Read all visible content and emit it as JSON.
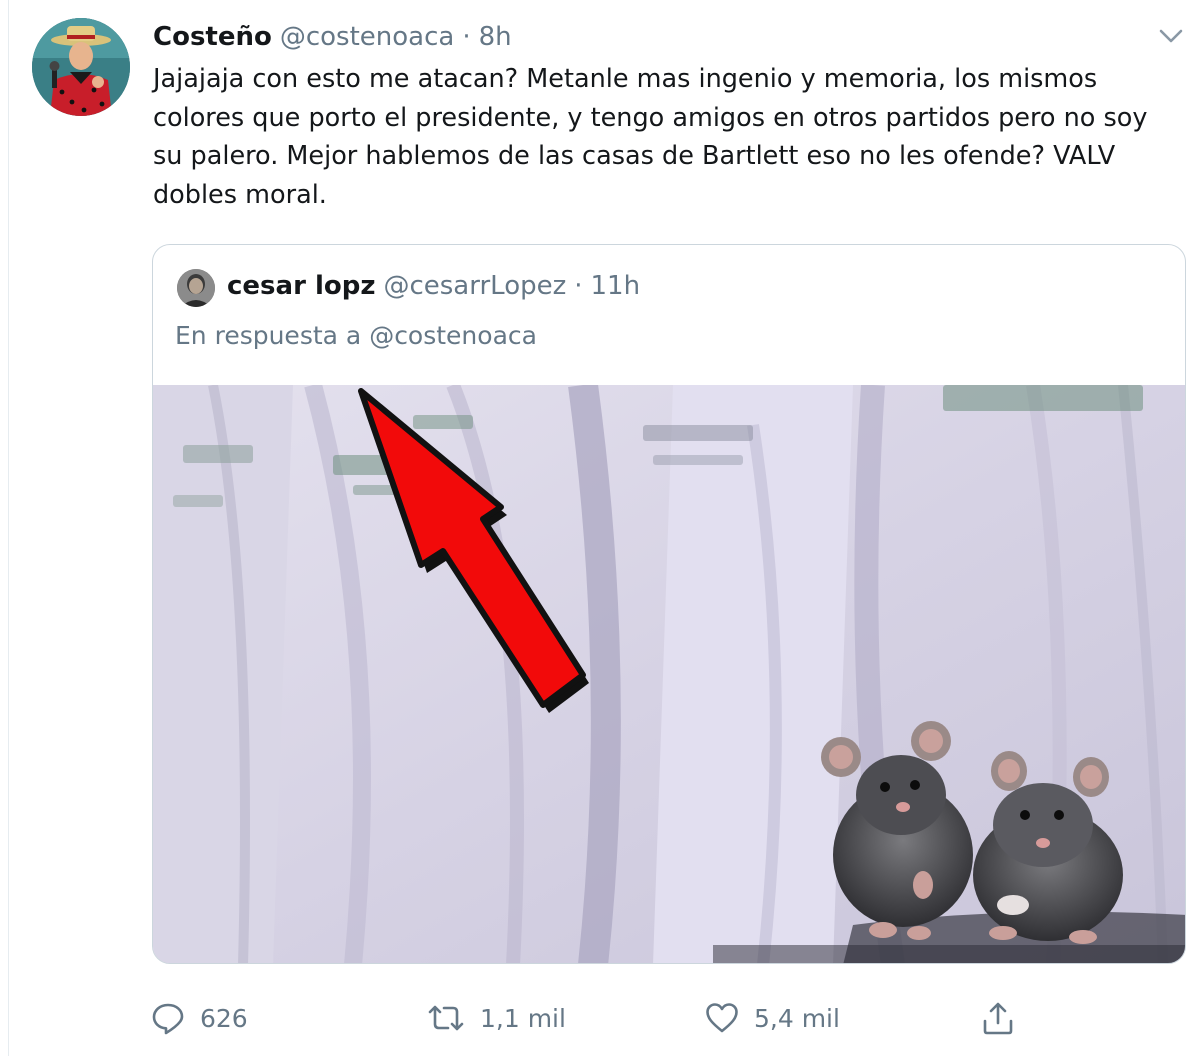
{
  "tweet": {
    "display_name": "Costeño",
    "handle": "@costenoaca",
    "separator": "·",
    "time": "8h",
    "text": "Jajajaja con esto me atacan? Metanle mas ingenio y memoria, los mismos colores que porto el presidente, y tengo amigos en otros partidos pero no soy su palero. Mejor hablemos de las casas de Bartlett eso no les ofende? VALV dobles moral.",
    "avatar_icon": "profile-photo",
    "menu_icon": "chevron-down-icon"
  },
  "quote": {
    "display_name": "cesar lopz",
    "handle": "@cesarrLopez",
    "separator": "·",
    "time": "11h",
    "reply_prefix": "En respuesta a",
    "reply_mention": "@costenoaca",
    "media_icon": "photo-white-shirts-red-arrow-rats"
  },
  "actions": {
    "reply_count": "626",
    "retweet_count": "1,1 mil",
    "like_count": "5,4 mil",
    "reply_icon": "comment-icon",
    "retweet_icon": "retweet-icon",
    "like_icon": "heart-icon",
    "share_icon": "share-icon"
  },
  "colors": {
    "text": "#14171a",
    "secondary": "#657786",
    "border": "#ccd6dd",
    "arrow": "#ee0000"
  }
}
